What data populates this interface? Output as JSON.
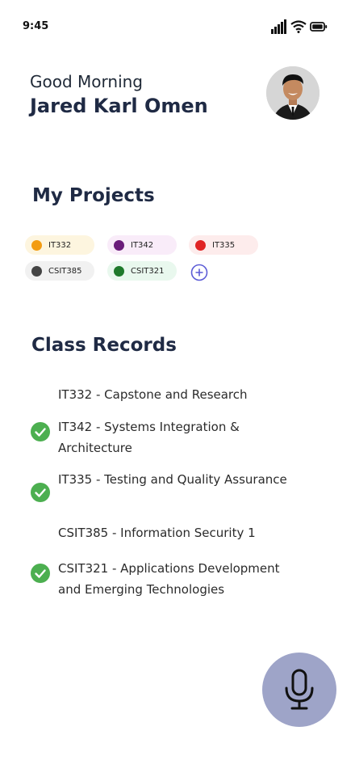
{
  "status_bar": {
    "time": "9:45"
  },
  "header": {
    "greeting": "Good Morning",
    "user_name": "Jared Karl Omen"
  },
  "projects": {
    "title": "My Projects",
    "chips": [
      {
        "label": "IT332",
        "dot_color": "#f39c12",
        "bg_color": "#fdf5df"
      },
      {
        "label": "IT342",
        "dot_color": "#6a1b7a",
        "bg_color": "#f9ecf9"
      },
      {
        "label": "IT335",
        "dot_color": "#e02424",
        "bg_color": "#fdecec"
      },
      {
        "label": "CSIT385",
        "dot_color": "#444444",
        "bg_color": "#f1f1f1"
      },
      {
        "label": "CSIT321",
        "dot_color": "#1e7a2b",
        "bg_color": "#e9f8ee"
      }
    ],
    "add_icon": "plus-circle-icon"
  },
  "class_records": {
    "title": "Class Records",
    "items": [
      {
        "label": "IT332 - Capstone and Research",
        "completed": false
      },
      {
        "label": "IT342 - Systems Integration & Architecture",
        "completed": true
      },
      {
        "label": "IT335 - Testing and Quality Assurance",
        "completed": true
      },
      {
        "label": "CSIT385 - Information Security 1",
        "completed": false
      },
      {
        "label": "CSIT321 - Applications Development and Emerging Technologies",
        "completed": true
      }
    ]
  },
  "fab": {
    "icon": "microphone-icon",
    "color": "#9ea4c8"
  }
}
